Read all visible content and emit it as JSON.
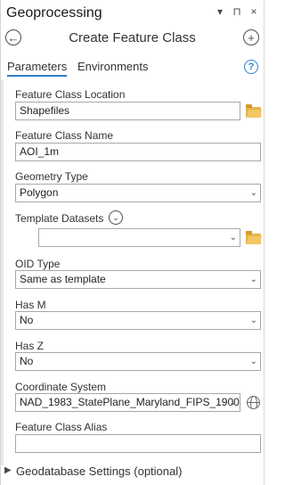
{
  "pane": {
    "title": "Geoprocessing",
    "controls": [
      "▾",
      "⊓",
      "×"
    ]
  },
  "tool": {
    "name": "Create Feature Class",
    "back_glyph": "←",
    "add_glyph": "+"
  },
  "tabs": {
    "parameters": "Parameters",
    "environments": "Environments",
    "help_glyph": "?"
  },
  "params": {
    "location": {
      "label": "Feature Class Location",
      "value": "Shapefiles"
    },
    "name": {
      "label": "Feature Class Name",
      "value": "AOI_1m"
    },
    "geometry": {
      "label": "Geometry Type",
      "value": "Polygon"
    },
    "template": {
      "label": "Template Datasets",
      "value": ""
    },
    "oid": {
      "label": "OID Type",
      "value": "Same as template"
    },
    "has_m": {
      "label": "Has M",
      "value": "No"
    },
    "has_z": {
      "label": "Has Z",
      "value": "No"
    },
    "coord": {
      "label": "Coordinate System",
      "value": "NAD_1983_StatePlane_Maryland_FIPS_1900_"
    },
    "alias": {
      "label": "Feature Class Alias",
      "value": ""
    }
  },
  "sections": {
    "geodatabase_settings": "Geodatabase Settings (optional)"
  },
  "glyphs": {
    "dropdown": "⌄",
    "chevron_down": "⌄",
    "expand": "▶"
  },
  "icons": {
    "back": "back-arrow-icon",
    "add": "add-icon",
    "help": "help-icon",
    "folder": "folder-icon",
    "chevron": "chevron-down-circle-icon",
    "globe": "globe-icon",
    "expand": "expand-arrow-icon"
  },
  "colors": {
    "accent": "#2f7fcf",
    "folder": "#e5b44a",
    "border": "#a8a8a8",
    "text": "#323232"
  }
}
